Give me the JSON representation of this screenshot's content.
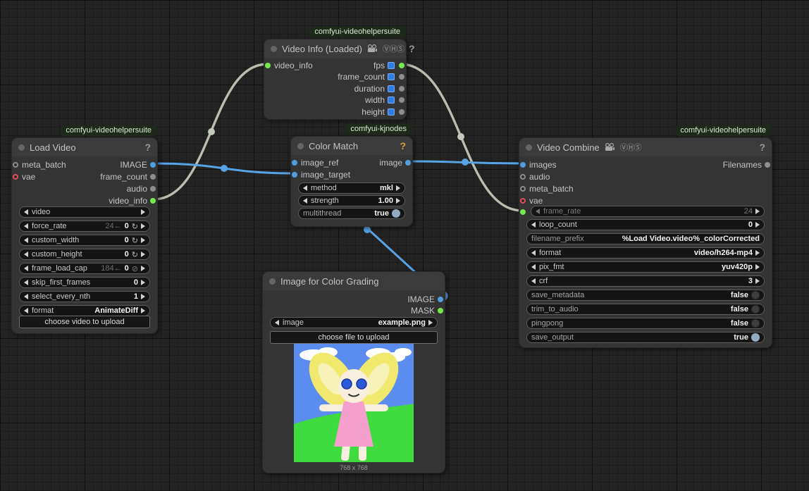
{
  "colors": {
    "link_image": "#58a3e4",
    "link_videoinfo": "#b7bfae",
    "slot_image_blue": "#4f9ee0",
    "slot_green": "#76e94c",
    "slot_gray": "#8e8e8e",
    "slot_vae_red": "#e05050",
    "convert_square_blue": "#2e7de4",
    "badge_bg": "#1d2a1a",
    "toggle_on": "#94aac2",
    "colormatch_help_accent": "#e0a030"
  },
  "icons": {
    "vhs": "ⓋⒽⓈ",
    "help": "?",
    "reset": "↻",
    "no_cap": "⊘"
  },
  "nodes": {
    "load_video": {
      "badge": "comfyui-videohelpersuite",
      "title": "Load Video",
      "inputs": [
        {
          "label": "meta_batch"
        },
        {
          "label": "vae"
        }
      ],
      "outputs": [
        {
          "label": "IMAGE"
        },
        {
          "label": "frame_count"
        },
        {
          "label": "audio"
        },
        {
          "label": "video_info"
        }
      ],
      "widgets": [
        {
          "label": "video",
          "value": ""
        },
        {
          "label": "force_rate",
          "ghost": "24←",
          "value": "0"
        },
        {
          "label": "custom_width",
          "value": "0"
        },
        {
          "label": "custom_height",
          "value": "0"
        },
        {
          "label": "frame_load_cap",
          "ghost": "184←",
          "value": "0"
        },
        {
          "label": "skip_first_frames",
          "value": "0"
        },
        {
          "label": "select_every_nth",
          "value": "1"
        },
        {
          "label": "format",
          "value": "AnimateDiff"
        }
      ],
      "upload_button": "choose video to upload"
    },
    "video_info": {
      "badge": "comfyui-videohelpersuite",
      "title": "Video Info (Loaded)",
      "inputs": [
        {
          "label": "video_info"
        }
      ],
      "outputs": [
        {
          "label": "fps"
        },
        {
          "label": "frame_count"
        },
        {
          "label": "duration"
        },
        {
          "label": "width"
        },
        {
          "label": "height"
        }
      ]
    },
    "color_match": {
      "badge": "comfyui-kjnodes",
      "title": "Color Match",
      "inputs": [
        {
          "label": "image_ref"
        },
        {
          "label": "image_target"
        }
      ],
      "outputs": [
        {
          "label": "image"
        }
      ],
      "widgets": [
        {
          "label": "method",
          "value": "mkl"
        },
        {
          "label": "strength",
          "value": "1.00"
        },
        {
          "label": "multithread",
          "value": "true"
        }
      ]
    },
    "video_combine": {
      "badge": "comfyui-videohelpersuite",
      "title": "Video Combine",
      "inputs": [
        {
          "label": "images"
        },
        {
          "label": "audio"
        },
        {
          "label": "meta_batch"
        },
        {
          "label": "vae"
        }
      ],
      "outputs": [
        {
          "label": "Filenames"
        }
      ],
      "converted_widget": {
        "label": "frame_rate",
        "value": "24"
      },
      "widgets": [
        {
          "label": "loop_count",
          "value": "0"
        },
        {
          "label": "filename_prefix",
          "value": "%Load Video.video%_colorCorrected"
        },
        {
          "label": "format",
          "value": "video/h264-mp4"
        },
        {
          "label": "pix_fmt",
          "value": "yuv420p"
        },
        {
          "label": "crf",
          "value": "3"
        },
        {
          "label": "save_metadata",
          "value": "false"
        },
        {
          "label": "trim_to_audio",
          "value": "false"
        },
        {
          "label": "pingpong",
          "value": "false"
        },
        {
          "label": "save_output",
          "value": "true"
        }
      ]
    },
    "image_load": {
      "title": "Image for Color Grading",
      "outputs": [
        {
          "label": "IMAGE"
        },
        {
          "label": "MASK"
        }
      ],
      "widgets": [
        {
          "label": "image",
          "value": "example.png"
        }
      ],
      "upload_button": "choose file to upload",
      "preview_caption": "768 x 768"
    }
  }
}
